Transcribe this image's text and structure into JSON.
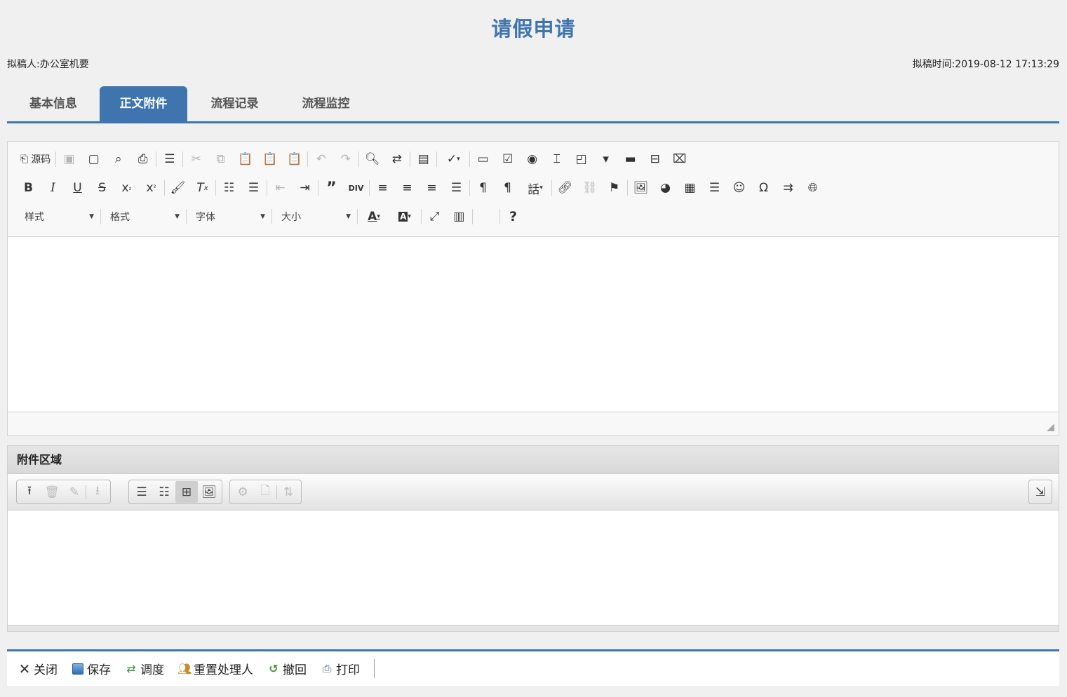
{
  "page": {
    "title": "请假申请",
    "drafter_label": "拟稿人:",
    "drafter_value": "办公室机要",
    "draft_time_label": "拟稿时间:",
    "draft_time_value": "2019-08-12 17:13:29"
  },
  "tabs": [
    {
      "label": "基本信息",
      "active": false
    },
    {
      "label": "正文附件",
      "active": true
    },
    {
      "label": "流程记录",
      "active": false
    },
    {
      "label": "流程监控",
      "active": false
    }
  ],
  "editor": {
    "source_label": "源码",
    "combos": {
      "style": "样式",
      "format": "格式",
      "font": "字体",
      "size": "大小"
    },
    "help_label": "?"
  },
  "attachments": {
    "title": "附件区域"
  },
  "actions": {
    "close": "关闭",
    "save": "保存",
    "dispatch": "调度",
    "reset_handler": "重置处理人",
    "withdraw": "撤回",
    "print": "打印"
  },
  "colors": {
    "accent": "#3f75ae",
    "background": "#f0f0f0"
  }
}
